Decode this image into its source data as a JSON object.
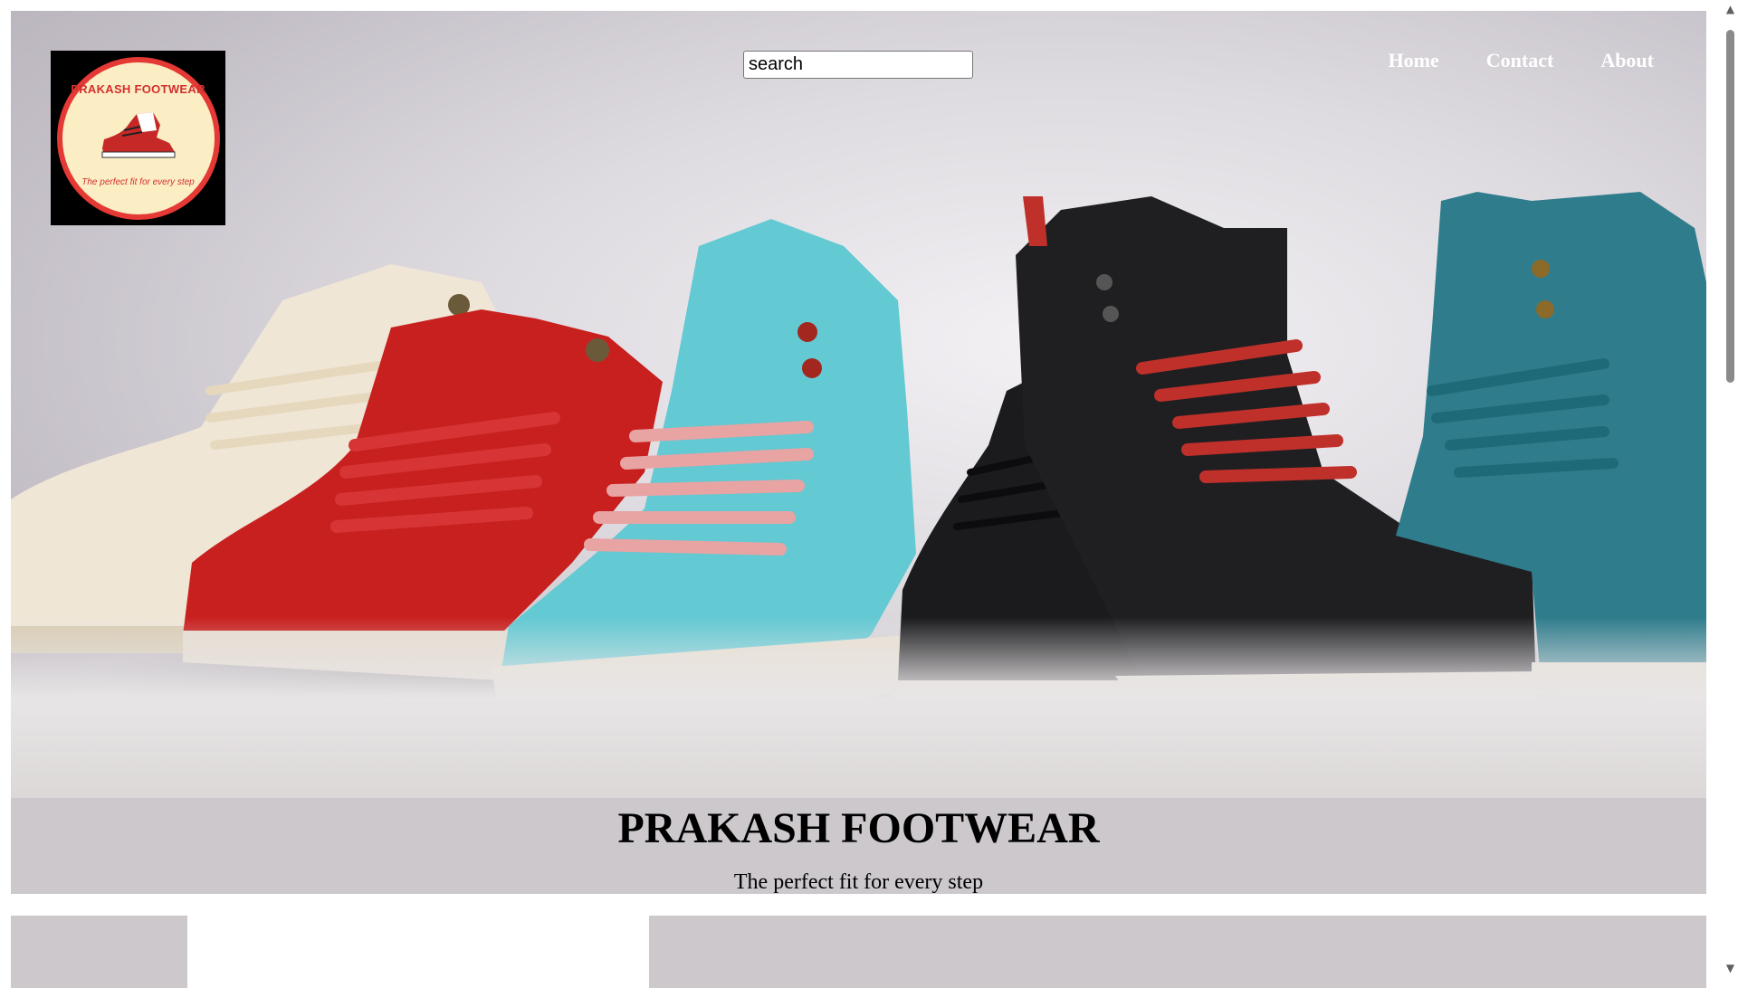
{
  "brand": {
    "logo_text": "PRAKASH FOOTWEAR",
    "logo_tagline": "The perfect fit for every step"
  },
  "search": {
    "placeholder": "search"
  },
  "nav": {
    "home": "Home",
    "contact": "Contact",
    "about": "About"
  },
  "hero": {
    "shoe_colors": [
      "#efe6d6",
      "#c8201f",
      "#63c9d3",
      "#1b1b1d",
      "#1f1f22",
      "#2f7c8c"
    ]
  },
  "banner": {
    "title": "PRAKASH FOOTWEAR",
    "subtitle": "The perfect fit for every step"
  },
  "scrollbar": {
    "up_icon": "▲",
    "down_icon": "▼"
  }
}
